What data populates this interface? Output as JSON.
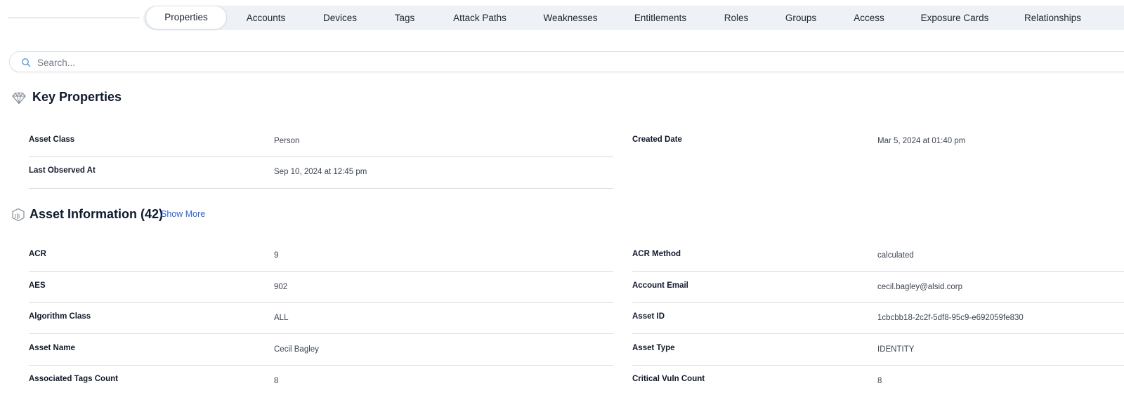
{
  "tabs": [
    {
      "label": "Properties",
      "active": true
    },
    {
      "label": "Accounts"
    },
    {
      "label": "Devices"
    },
    {
      "label": "Tags"
    },
    {
      "label": "Attack Paths"
    },
    {
      "label": "Weaknesses"
    },
    {
      "label": "Entitlements"
    },
    {
      "label": "Roles"
    },
    {
      "label": "Groups"
    },
    {
      "label": "Access"
    },
    {
      "label": "Exposure Cards"
    },
    {
      "label": "Relationships"
    }
  ],
  "search": {
    "placeholder": "Search...",
    "value": "",
    "icon": "search-icon"
  },
  "key_properties": {
    "title": "Key Properties",
    "icon": "diamond-icon",
    "items": [
      {
        "label": "Asset Class",
        "value": "Person"
      },
      {
        "label": "Created Date",
        "value": "Mar 5, 2024 at 01:40 pm"
      },
      {
        "label": "Last Observed At",
        "value": "Sep 10, 2024 at 12:45 pm"
      }
    ]
  },
  "asset_information": {
    "title": "Asset Information (42)",
    "icon": "cube-icon",
    "show_more_label": "Show More",
    "items": [
      {
        "label": "ACR",
        "value": "9"
      },
      {
        "label": "ACR Method",
        "value": "calculated"
      },
      {
        "label": "AES",
        "value": "902"
      },
      {
        "label": "Account Email",
        "value": "cecil.bagley@alsid.corp"
      },
      {
        "label": "Algorithm Class",
        "value": "ALL"
      },
      {
        "label": "Asset ID",
        "value": "1cbcbb18-2c2f-5df8-95c9-e692059fe830"
      },
      {
        "label": "Asset Name",
        "value": "Cecil Bagley"
      },
      {
        "label": "Asset Type",
        "value": "IDENTITY"
      },
      {
        "label": "Associated Tags Count",
        "value": "8"
      },
      {
        "label": "Critical Vuln Count",
        "value": "8"
      }
    ]
  },
  "colors": {
    "accent": "#2f63d6",
    "tab_background": "#eef2f6",
    "text": "#0f1b2d"
  }
}
